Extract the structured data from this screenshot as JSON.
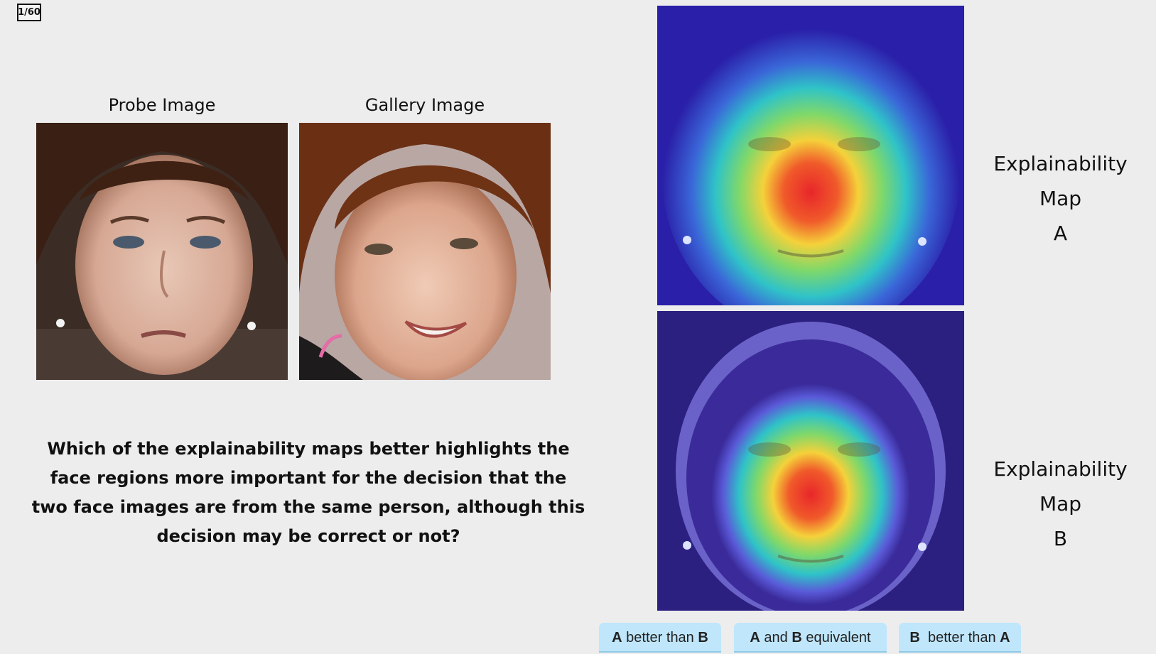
{
  "counter": "1/60",
  "probe": {
    "label": "Probe Image"
  },
  "gallery": {
    "label": "Gallery Image"
  },
  "question": "Which of the explainability maps better highlights the face regions more important for the decision that the two face images are from the same person, although this decision may be correct or not?",
  "map_a": {
    "line1": "Explainability Map",
    "line2": "A"
  },
  "map_b": {
    "line1": "Explainability Map",
    "line2": "B"
  },
  "choices": [
    {
      "bold1": "A",
      "mid": " better than ",
      "bold2": "B"
    },
    {
      "bold1": "A",
      "mid": " and ",
      "bold2": "B",
      "tail": " equivalent"
    },
    {
      "bold1": "B",
      "mid": "  better than ",
      "bold2": "A"
    }
  ],
  "colors": {
    "background": "#ededed",
    "button": "#bfe6fb",
    "heatmap_bg": "#2a1fa8",
    "heatmap_hot": "#e8262a"
  }
}
